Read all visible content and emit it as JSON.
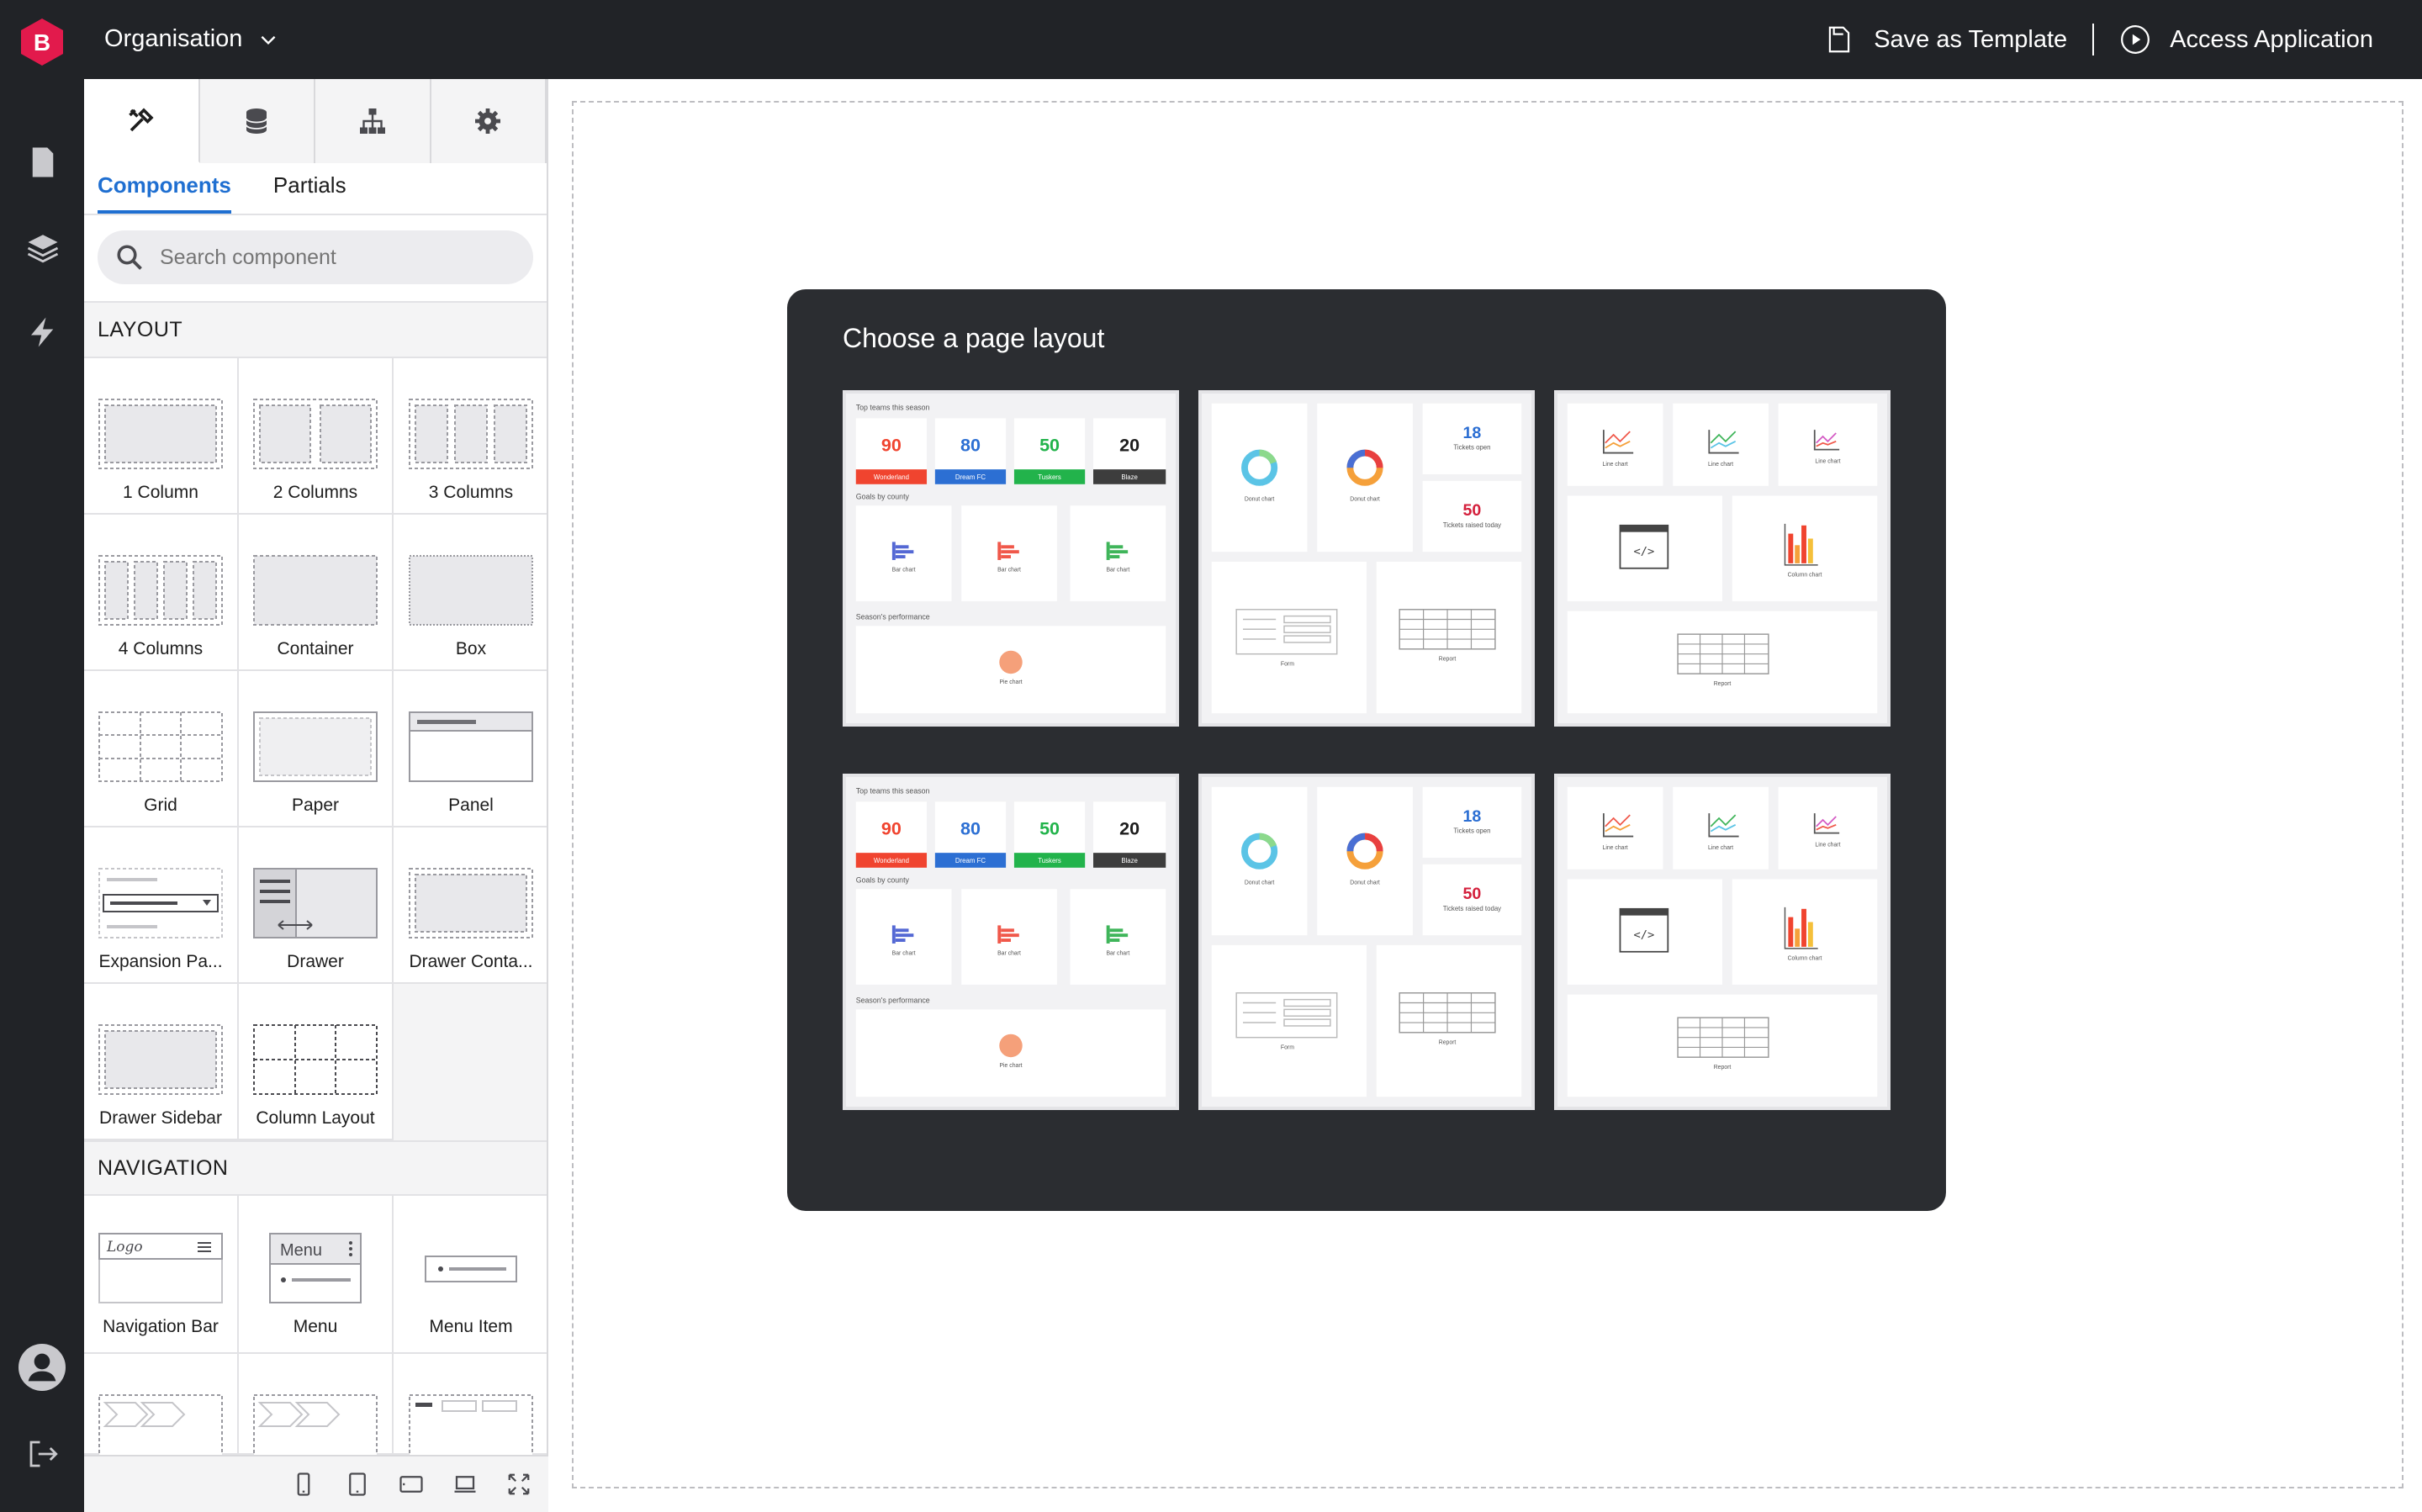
{
  "app": {
    "logo_letter": "B",
    "brand_color": "#e21a4c",
    "org_name": "Organisation"
  },
  "topbar": {
    "save_template": "Save as Template",
    "access_app": "Access Application"
  },
  "rail": {
    "items": [
      "pages-icon",
      "layers-icon",
      "bolt-icon"
    ],
    "bottom": [
      "user-avatar-icon",
      "logout-icon"
    ]
  },
  "panel": {
    "tabs": [
      "components-icon",
      "database-icon",
      "sitemap-icon",
      "gear-icon"
    ],
    "subtabs": [
      "Components",
      "Partials"
    ],
    "search_placeholder": "Search component",
    "layout_title": "LAYOUT",
    "layout_items": [
      "1 Column",
      "2 Columns",
      "3 Columns",
      "4 Columns",
      "Container",
      "Box",
      "Grid",
      "Paper",
      "Panel",
      "Expansion Pa...",
      "Drawer",
      "Drawer Conta...",
      "Drawer Sidebar",
      "Column Layout"
    ],
    "navigation_title": "NAVIGATION",
    "navigation_items": [
      "Navigation Bar",
      "Menu",
      "Menu Item"
    ],
    "nav_menu_thumb_text": "Menu",
    "nav_logo_thumb_text": "Logo"
  },
  "modal": {
    "title": "Choose a page layout",
    "cards": [
      {
        "kind": "sports",
        "heading1": "Top teams this season",
        "scores": [
          {
            "value": "90",
            "team": "Wonderland",
            "color": "#f0442f"
          },
          {
            "value": "80",
            "team": "Dream FC",
            "color": "#2c6fd3"
          },
          {
            "value": "50",
            "team": "Tuskers",
            "color": "#22b34b"
          },
          {
            "value": "20",
            "team": "Blaze",
            "color": "#3d3d3d"
          }
        ],
        "heading2": "Goals by county",
        "bar_label": "Bar chart",
        "heading3": "Season's performance",
        "pie_label": "Pie chart"
      },
      {
        "kind": "tickets",
        "donut_label": "Donut chart",
        "open_value": "18",
        "open_label": "Tickets open",
        "raised_value": "50",
        "raised_label": "Tickets raised today",
        "form_label": "Form",
        "report_label": "Report"
      },
      {
        "kind": "charts",
        "line_label": "Line chart",
        "column_label": "Column chart",
        "report_label": "Report"
      },
      {
        "kind": "sports",
        "heading1": "Top teams this season",
        "scores": [
          {
            "value": "90",
            "team": "Wonderland",
            "color": "#f0442f"
          },
          {
            "value": "80",
            "team": "Dream FC",
            "color": "#2c6fd3"
          },
          {
            "value": "50",
            "team": "Tuskers",
            "color": "#22b34b"
          },
          {
            "value": "20",
            "team": "Blaze",
            "color": "#3d3d3d"
          }
        ],
        "heading2": "Goals by county",
        "bar_label": "Bar chart",
        "heading3": "Season's performance",
        "pie_label": "Pie chart"
      },
      {
        "kind": "tickets",
        "donut_label": "Donut chart",
        "open_value": "18",
        "open_label": "Tickets open",
        "raised_value": "50",
        "raised_label": "Tickets raised today",
        "form_label": "Form",
        "report_label": "Report"
      },
      {
        "kind": "charts",
        "line_label": "Line chart",
        "column_label": "Column chart",
        "report_label": "Report"
      }
    ]
  }
}
